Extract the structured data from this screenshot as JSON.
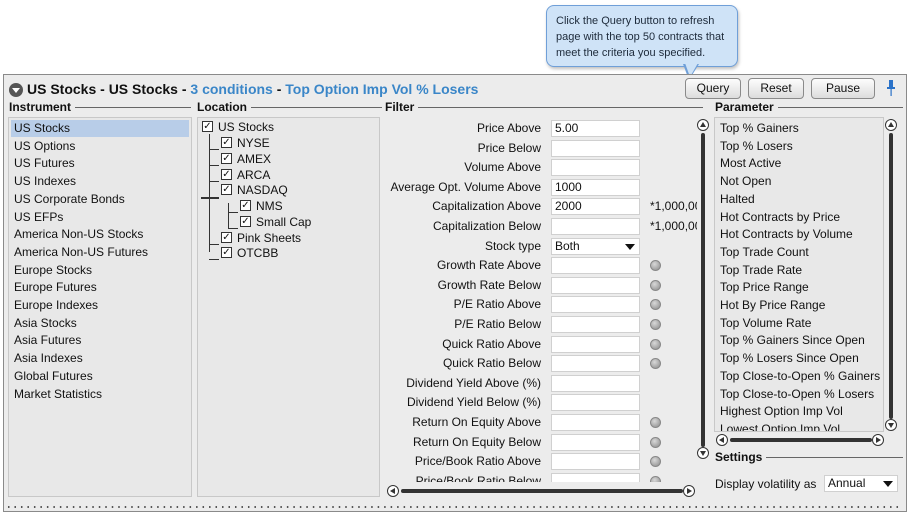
{
  "tooltip": {
    "text": "Click the Query button to refresh page with the top 50 contracts that meet the criteria you specified."
  },
  "titlebar": {
    "instrument_title": "US Stocks - US Stocks -",
    "conditions": "3 conditions",
    "separator": "-",
    "scan_name": "Top Option Imp Vol % Losers",
    "query_label": "Query",
    "reset_label": "Reset",
    "pause_label": "Pause"
  },
  "instrument": {
    "header": "Instrument",
    "items": [
      "US Stocks",
      "US Options",
      "US Futures",
      "US Indexes",
      "US Corporate Bonds",
      "US EFPs",
      "America Non-US Stocks",
      "America Non-US Futures",
      "Europe Stocks",
      "Europe Futures",
      "Europe Indexes",
      "Asia Stocks",
      "Asia Futures",
      "Asia Indexes",
      "Global Futures",
      "Market Statistics"
    ],
    "selected": "US Stocks"
  },
  "location": {
    "header": "Location",
    "root": "US Stocks",
    "nyse": "NYSE",
    "amex": "AMEX",
    "arca": "ARCA",
    "nasdaq": "NASDAQ",
    "nms": "NMS",
    "small_cap": "Small Cap",
    "pink_sheets": "Pink Sheets",
    "otcbb": "OTCBB",
    "check_glyph": "✓"
  },
  "filter": {
    "header": "Filter",
    "rows": [
      {
        "label": "Price Above",
        "value": "5.00",
        "unit": "",
        "help": false
      },
      {
        "label": "Price Below",
        "value": "",
        "unit": "",
        "help": false
      },
      {
        "label": "Volume Above",
        "value": "",
        "unit": "",
        "help": false
      },
      {
        "label": "Average Opt. Volume Above",
        "value": "1000",
        "unit": "",
        "help": false
      },
      {
        "label": "Capitalization Above",
        "value": "2000",
        "unit": "*1,000,00",
        "help": false
      },
      {
        "label": "Capitalization Below",
        "value": "",
        "unit": "*1,000,00",
        "help": false
      },
      {
        "label": "Stock type",
        "value": "Both",
        "unit": "",
        "help": false
      },
      {
        "label": "Growth Rate Above",
        "value": "",
        "unit": "",
        "help": true
      },
      {
        "label": "Growth Rate Below",
        "value": "",
        "unit": "",
        "help": true
      },
      {
        "label": "P/E Ratio Above",
        "value": "",
        "unit": "",
        "help": true
      },
      {
        "label": "P/E Ratio Below",
        "value": "",
        "unit": "",
        "help": true
      },
      {
        "label": "Quick Ratio Above",
        "value": "",
        "unit": "",
        "help": true
      },
      {
        "label": "Quick Ratio Below",
        "value": "",
        "unit": "",
        "help": true
      },
      {
        "label": "Dividend Yield Above (%)",
        "value": "",
        "unit": "",
        "help": false
      },
      {
        "label": "Dividend Yield Below (%)",
        "value": "",
        "unit": "",
        "help": false
      },
      {
        "label": "Return On Equity Above",
        "value": "",
        "unit": "",
        "help": true
      },
      {
        "label": "Return On Equity Below",
        "value": "",
        "unit": "",
        "help": true
      },
      {
        "label": "Price/Book Ratio Above",
        "value": "",
        "unit": "",
        "help": true
      },
      {
        "label": "Price/Book Ratio Below",
        "value": "",
        "unit": "",
        "help": true
      }
    ]
  },
  "parameter": {
    "header": "Parameter",
    "items": [
      "Top % Gainers",
      "Top % Losers",
      "Most Active",
      "Not Open",
      "Halted",
      "Hot Contracts by Price",
      "Hot Contracts by Volume",
      "Top Trade Count",
      "Top Trade Rate",
      "Top Price Range",
      "Hot By Price Range",
      "Top Volume Rate",
      "Top % Gainers Since Open",
      "Top % Losers Since Open",
      "Top Close-to-Open % Gainers",
      "Top Close-to-Open % Losers",
      "Highest Option Imp Vol",
      "Lowest Option Imp Vol"
    ]
  },
  "settings": {
    "header": "Settings",
    "volatility_label": "Display volatility as",
    "volatility_value": "Annual"
  }
}
